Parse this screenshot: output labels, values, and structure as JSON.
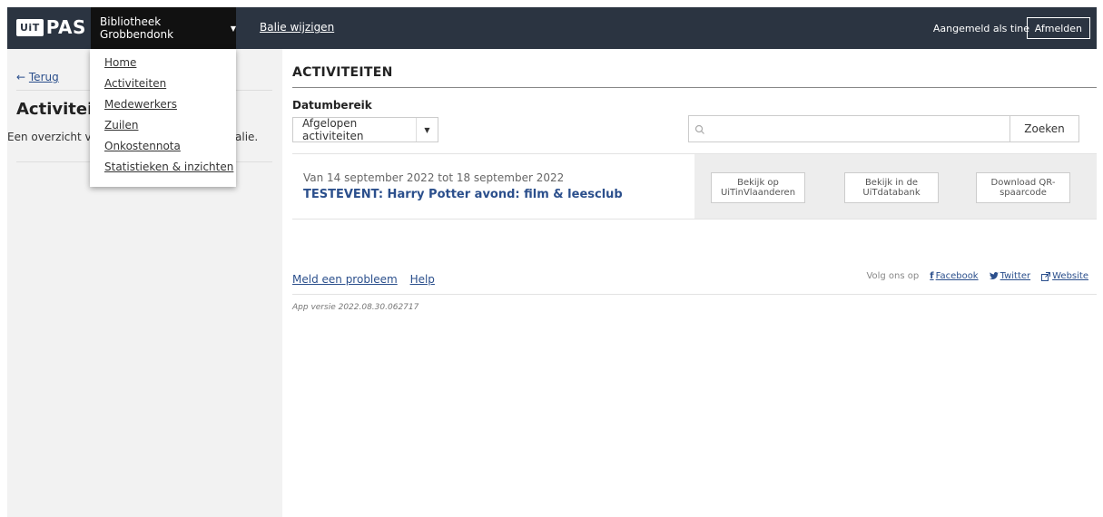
{
  "topbar": {
    "logo_uit": "UiT",
    "logo_pas": "PAS",
    "balie_name": "Bibliotheek Grobbendonk",
    "balie_wijzigen": "Balie wijzigen",
    "logged_in_text": "Aangemeld als tine",
    "logout_label": "Afmelden",
    "bg_color": "#2b3441"
  },
  "menu": {
    "items": [
      {
        "label": "Home"
      },
      {
        "label": "Activiteiten"
      },
      {
        "label": "Medewerkers"
      },
      {
        "label": "Zuilen"
      },
      {
        "label": "Onkostennota"
      },
      {
        "label": "Statistieken & inzichten"
      }
    ]
  },
  "sidebar": {
    "back_label": "Terug",
    "title": "Activitei",
    "description_start": "Een overzicht v",
    "description_end": "alie."
  },
  "main": {
    "title": "ACTIVITEITEN",
    "filter_label": "Datumbereik",
    "date_range_value": "Afgelopen activiteiten",
    "search_placeholder": "",
    "search_button": "Zoeken",
    "activities": [
      {
        "date_range": "Van 14 september 2022 tot 18 september 2022",
        "title": "TESTEVENT: Harry Potter avond: film & leesclub",
        "buttons": [
          "Bekijk op UiTinVlaanderen",
          "Bekijk in de UiTdatabank",
          "Download QR-spaarcode"
        ]
      }
    ]
  },
  "footer": {
    "report_problem": "Meld een probleem",
    "help": "Help",
    "follow_us": "Volg ons op",
    "facebook": "Facebook",
    "twitter": "Twitter",
    "website": "Website",
    "app_version": "App versie 2022.08.30.062717"
  }
}
